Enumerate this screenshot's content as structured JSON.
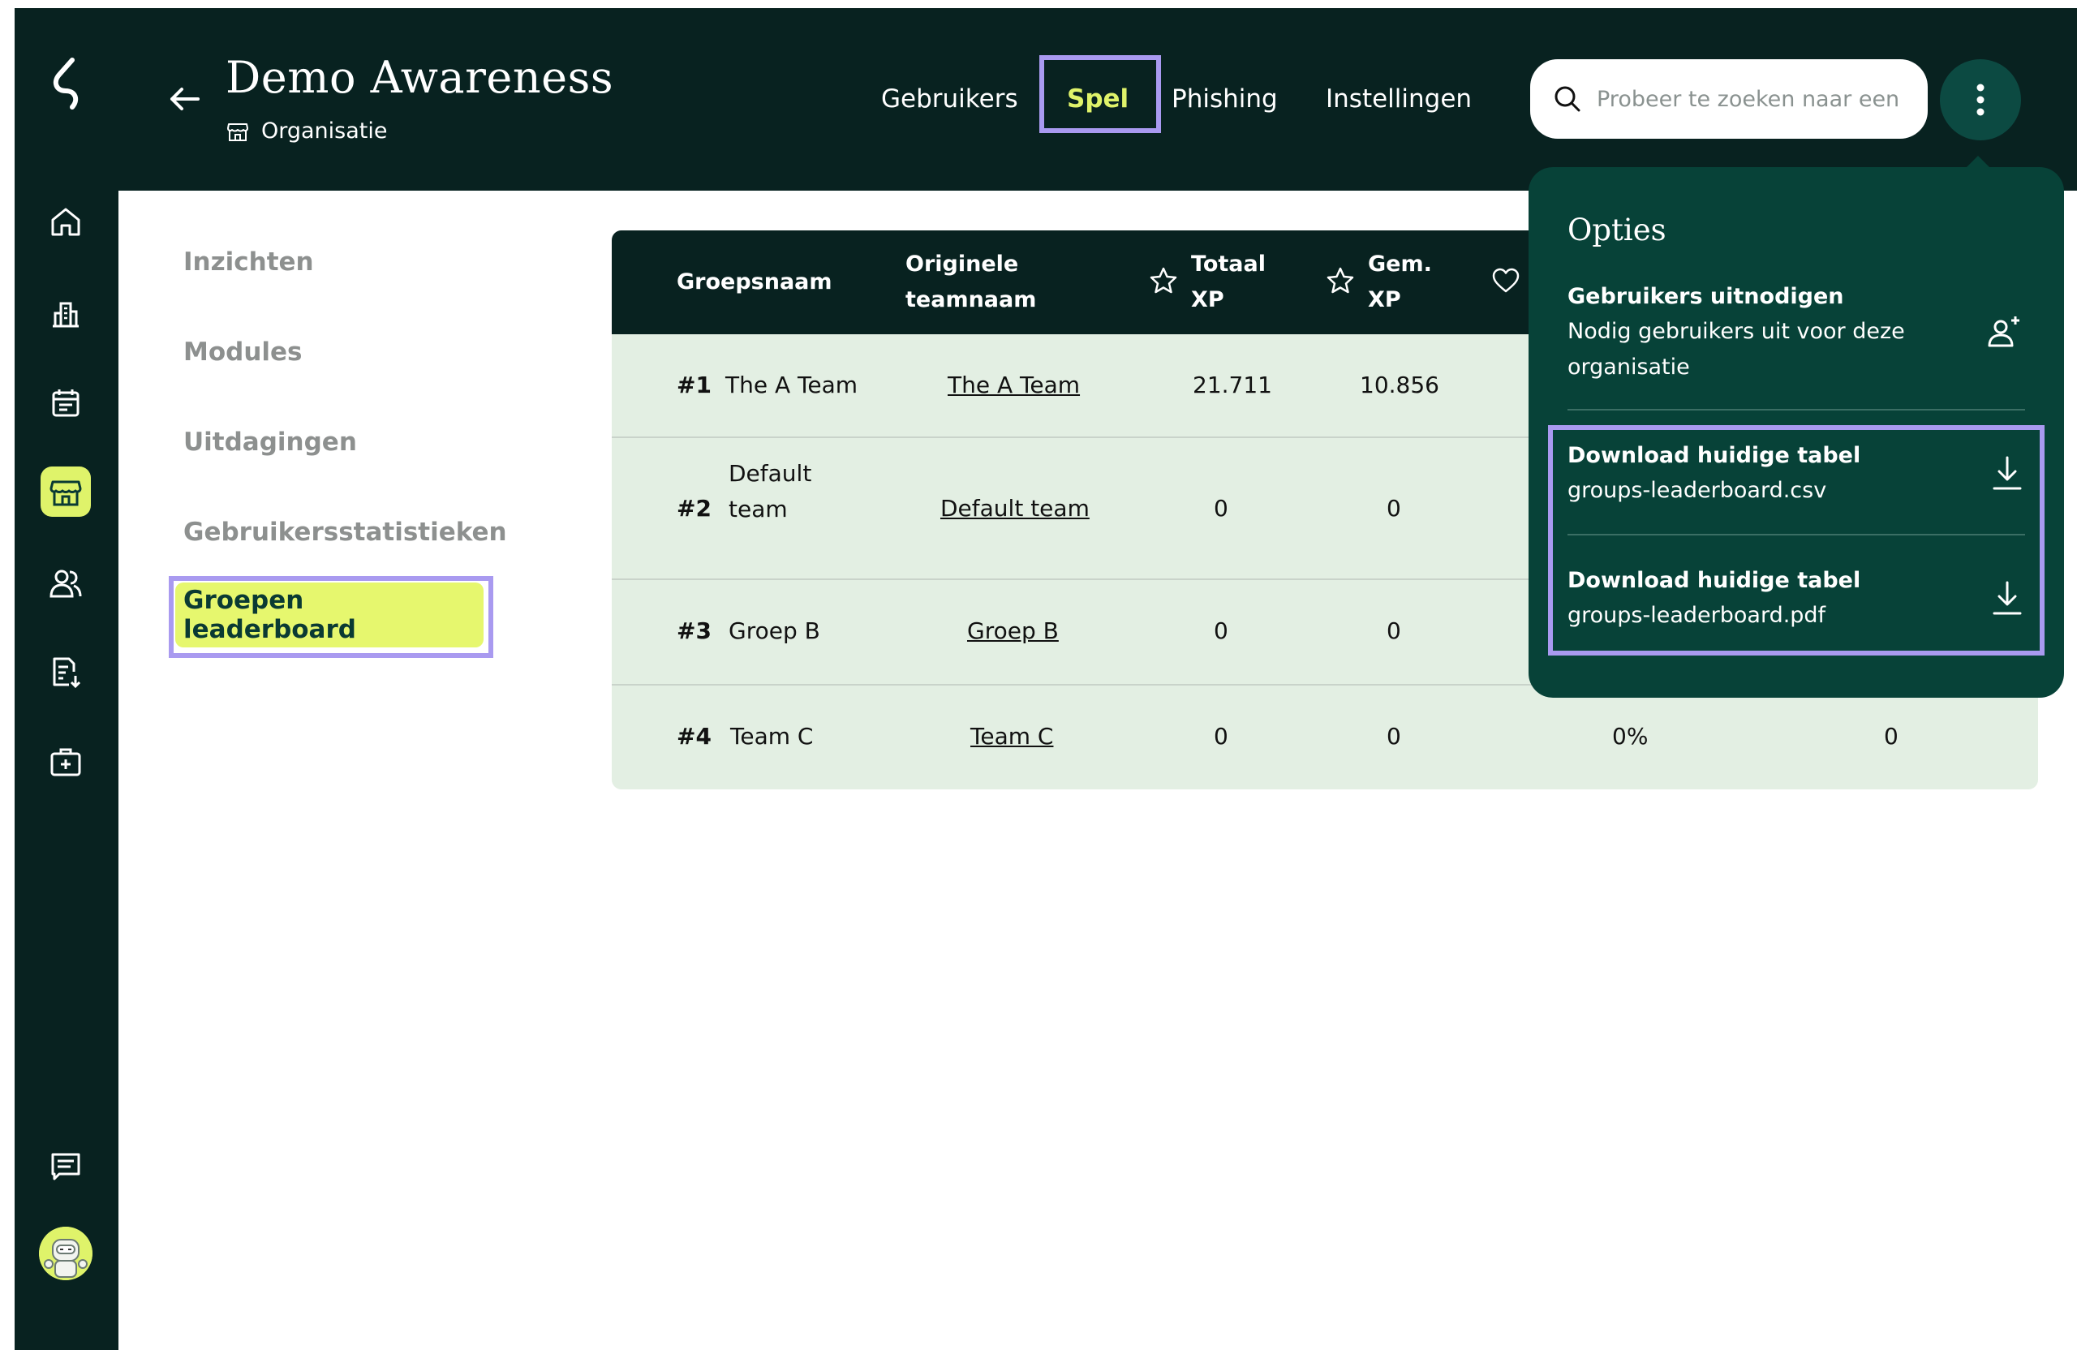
{
  "header": {
    "title": "Demo Awareness",
    "subtitle": "Organisatie",
    "tabs": [
      {
        "label": "Gebruikers",
        "active": false
      },
      {
        "label": "Spel",
        "active": true
      },
      {
        "label": "Phishing",
        "active": false
      },
      {
        "label": "Instellingen",
        "active": false
      }
    ],
    "search_placeholder": "Probeer te zoeken naar een r"
  },
  "sidebar": {
    "icons": [
      "home-icon",
      "building-icon",
      "calendar-icon",
      "store-icon",
      "users-icon",
      "report-download-icon",
      "first-aid-kit-icon",
      "chat-icon",
      "avatar"
    ],
    "active": "store-icon"
  },
  "subnav": {
    "items": [
      "Inzichten",
      "Modules",
      "Uitdagingen",
      "Gebruikersstatistieken",
      "Groepen leaderboard"
    ],
    "active": "Groepen leaderboard"
  },
  "table": {
    "headers": {
      "group_name": "Groepsnaam",
      "original_team": [
        "Originele",
        "teamnaam"
      ],
      "total_xp": [
        "Totaal",
        "XP"
      ],
      "avg_xp": [
        "Gem.",
        "XP"
      ]
    },
    "rows": [
      {
        "rank": "#1",
        "name": "The A Team",
        "original": "The A Team",
        "total_xp": "21.711",
        "avg_xp": "10.856",
        "pct": "",
        "last": ""
      },
      {
        "rank": "#2",
        "name": "Default team",
        "original": "Default team",
        "total_xp": "0",
        "avg_xp": "0",
        "pct": "",
        "last": ""
      },
      {
        "rank": "#3",
        "name": "Groep B",
        "original": "Groep B",
        "total_xp": "0",
        "avg_xp": "0",
        "pct": "",
        "last": ""
      },
      {
        "rank": "#4",
        "name": "Team C",
        "original": "Team C",
        "total_xp": "0",
        "avg_xp": "0",
        "pct": "0%",
        "last": "0"
      }
    ]
  },
  "options": {
    "title": "Opties",
    "items": [
      {
        "title": "Gebruikers uitnodigen",
        "desc": "Nodig gebruikers uit voor deze organisatie"
      },
      {
        "title": "Download huidige tabel",
        "desc": "groups-leaderboard.csv"
      },
      {
        "title": "Download huidige tabel",
        "desc": "groups-leaderboard.pdf"
      }
    ]
  },
  "colors": {
    "dark": "#082220",
    "accent": "#dff36a",
    "panel": "#074238",
    "table_bg": "#e3efe3",
    "highlight": "#a99af0"
  }
}
